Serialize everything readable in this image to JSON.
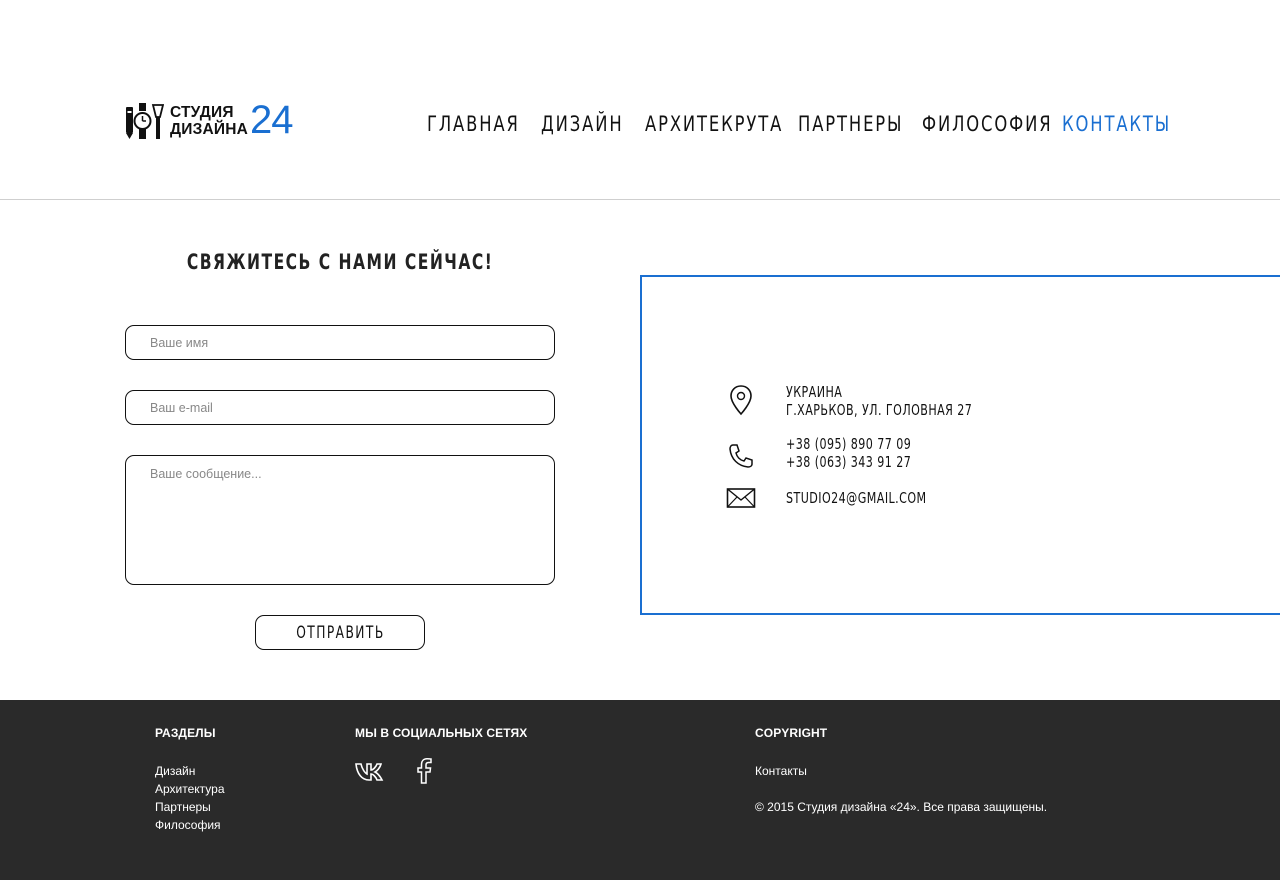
{
  "header": {
    "logo": {
      "line1": "СТУДИЯ",
      "line2": "ДИЗАЙНА",
      "number": "24"
    },
    "nav": [
      {
        "label": "Главная",
        "active": false
      },
      {
        "label": "Дизайн",
        "active": false
      },
      {
        "label": "Архитекрута",
        "active": false
      },
      {
        "label": "Партнеры",
        "active": false
      },
      {
        "label": "Философия",
        "active": false
      },
      {
        "label": "Контакты",
        "active": true
      }
    ],
    "accent_color": "#1a6fd1"
  },
  "contact_form": {
    "title": "Свяжитесь с нами сейчас!",
    "name_placeholder": "Ваше имя",
    "email_placeholder": "Ваш e-mail",
    "message_placeholder": "Ваше сообщение...",
    "submit_label": "Отправить"
  },
  "contact_info": {
    "address": {
      "icon": "location-pin-icon",
      "line1": "Украина",
      "line2": "г.Харьков, ул. Головная 27"
    },
    "phones": {
      "icon": "phone-icon",
      "line1": "+38 (095) 890 77 09",
      "line2": "+38 (063) 343 91 27"
    },
    "email": {
      "icon": "envelope-icon",
      "value": "studio24@gmail.com"
    }
  },
  "footer": {
    "sections": {
      "heading": "РАЗДЕЛЫ",
      "links": [
        "Дизайн",
        "Архитектура",
        "Партнеры",
        "Философия"
      ]
    },
    "social": {
      "heading": "МЫ В СОЦИАЛЬНЫХ СЕТЯХ",
      "icons": [
        "vk-icon",
        "facebook-icon"
      ]
    },
    "copyright": {
      "heading": "COPYRIGHT",
      "link": "Контакты",
      "text": "© 2015 Студия дизайна «24». Все права защищены."
    },
    "background_color": "#2a2a2a"
  }
}
